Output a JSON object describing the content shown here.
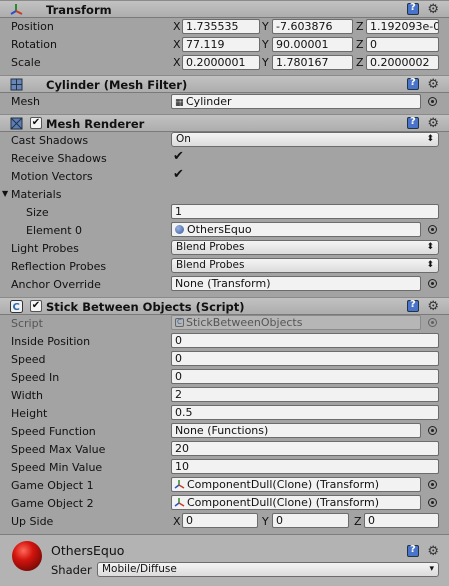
{
  "transform": {
    "title": "Transform",
    "position": {
      "label": "Position",
      "x": "1.735535",
      "y": "-7.603876",
      "z": "1.192093e-0"
    },
    "rotation": {
      "label": "Rotation",
      "x": "77.119",
      "y": "90.00001",
      "z": "0"
    },
    "scale": {
      "label": "Scale",
      "x": "0.2000001",
      "y": "1.780167",
      "z": "0.2000002"
    },
    "axis": {
      "x": "X",
      "y": "Y",
      "z": "Z"
    }
  },
  "mesh_filter": {
    "title": "Cylinder (Mesh Filter)",
    "mesh_label": "Mesh",
    "mesh_value": "Cylinder"
  },
  "mesh_renderer": {
    "title": "Mesh Renderer",
    "check": "✔",
    "cast_shadows": {
      "label": "Cast Shadows",
      "value": "On"
    },
    "receive_shadows": {
      "label": "Receive Shadows",
      "check": "✔"
    },
    "motion_vectors": {
      "label": "Motion Vectors",
      "check": "✔"
    },
    "materials": {
      "label": "Materials",
      "size_label": "Size",
      "size_value": "1",
      "element_label": "Element 0",
      "element_value": "OthersEquo"
    },
    "light_probes": {
      "label": "Light Probes",
      "value": "Blend Probes"
    },
    "reflection_probes": {
      "label": "Reflection Probes",
      "value": "Blend Probes"
    },
    "anchor_override": {
      "label": "Anchor Override",
      "value": "None (Transform)"
    }
  },
  "script": {
    "title": "Stick Between Objects (Script)",
    "check": "✔",
    "script_label": "Script",
    "script_value": "StickBetweenObjects",
    "fields": [
      {
        "label": "Inside Position",
        "value": "0"
      },
      {
        "label": "Speed",
        "value": "0"
      },
      {
        "label": "Speed In",
        "value": "0"
      },
      {
        "label": "Width",
        "value": "2"
      },
      {
        "label": "Height",
        "value": "0.5"
      }
    ],
    "speed_function": {
      "label": "Speed Function",
      "value": "None (Functions)"
    },
    "speed_max": {
      "label": "Speed Max Value",
      "value": "20"
    },
    "speed_min": {
      "label": "Speed Min Value",
      "value": "10"
    },
    "game_object_1": {
      "label": "Game Object 1",
      "value": "ComponentDull(Clone) (Transform)"
    },
    "game_object_2": {
      "label": "Game Object 2",
      "value": "ComponentDull(Clone) (Transform)"
    },
    "up_side": {
      "label": "Up Side",
      "x": "0",
      "y": "0",
      "z": "0"
    }
  },
  "material": {
    "name": "OthersEquo",
    "shader_label": "Shader",
    "shader_value": "Mobile/Diffuse"
  },
  "icons": {
    "gear": "gear-icon",
    "help": "help-icon"
  },
  "colors": {
    "header": "#b8b8b8",
    "body": "#a3a3a3",
    "field": "#f2f2f2",
    "material_ball": "#c4100c"
  }
}
